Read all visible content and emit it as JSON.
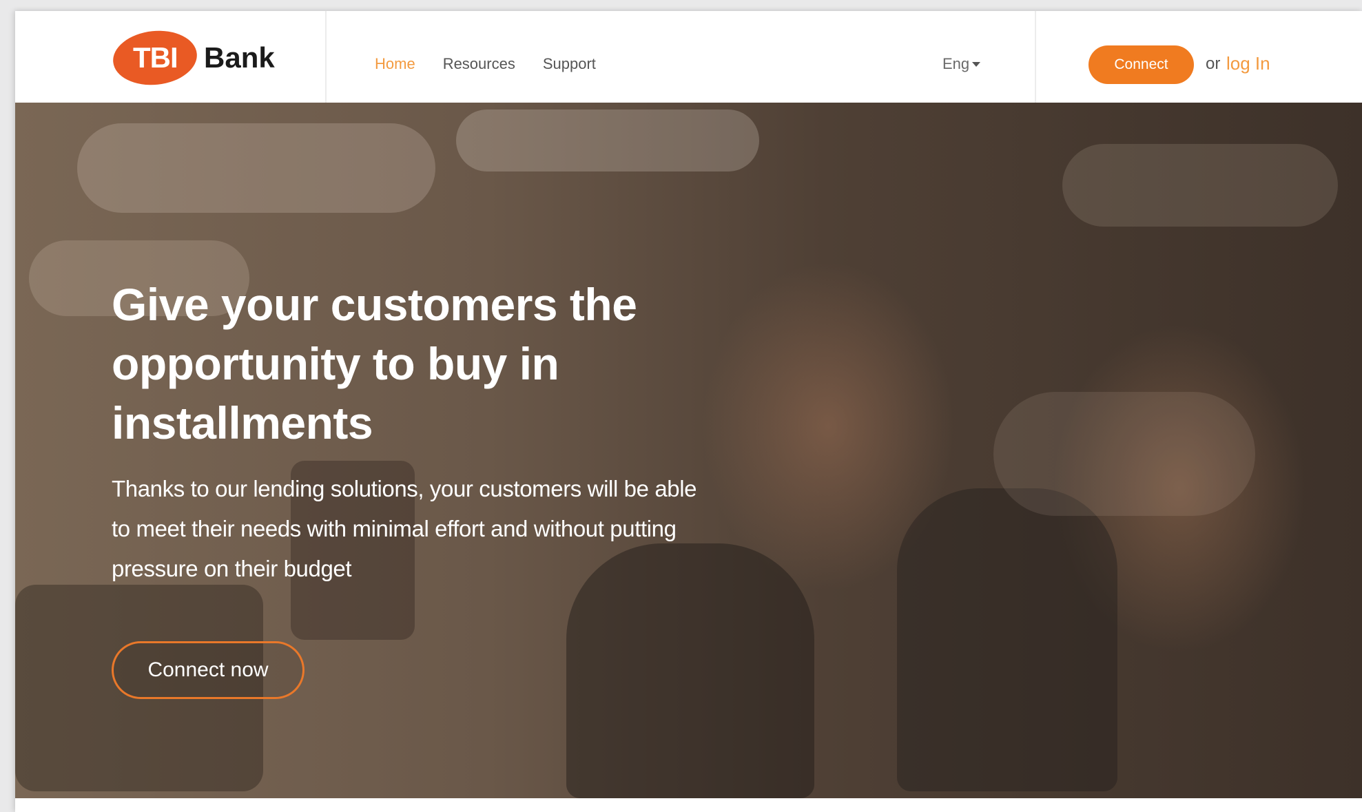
{
  "header": {
    "logo_badge": "TBI",
    "logo_word": "Bank",
    "nav": [
      {
        "label": "Home",
        "active": true
      },
      {
        "label": "Resources",
        "active": false
      },
      {
        "label": "Support",
        "active": false
      }
    ],
    "language": "Eng",
    "connect_label": "Connect",
    "or_text": "or",
    "login_label": "log In"
  },
  "hero": {
    "title": "Give your customers the opportunity to buy in installments",
    "text": "Thanks to our lending solutions, your customers will be able to meet their needs with minimal effort and without putting pressure on their budget",
    "cta_label": "Connect now",
    "image_icon": "couple-smiling-photo"
  },
  "colors": {
    "brand": "#e95a24",
    "accent": "#f07b20",
    "link": "#f39a3f",
    "text_dark": "#1b1b1b"
  }
}
